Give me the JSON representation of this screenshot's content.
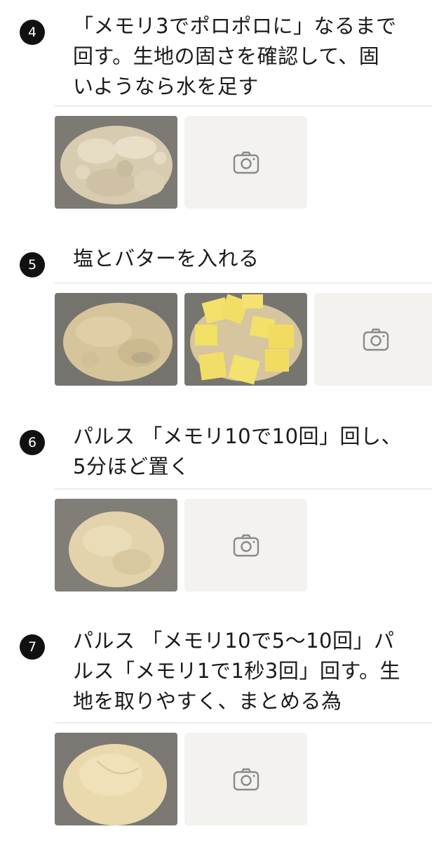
{
  "steps": [
    {
      "number": "4",
      "text": "「メモリ3でポロポロに」なるまで\n回す。生地の固さを確認して、固\nいようなら水を足す",
      "photos": [
        "crumbly-dough-photo"
      ]
    },
    {
      "number": "5",
      "text": "塩とバターを入れる",
      "photos": [
        "salted-dough-photo",
        "butter-cubes-photo"
      ]
    },
    {
      "number": "6",
      "text": "パルス 「メモリ10で10回」回し、\n5分ほど置く",
      "photos": [
        "rested-dough-photo"
      ]
    },
    {
      "number": "7",
      "text": "パルス 「メモリ10で5〜10回」パ\nルス「メモリ1で1秒3回」回す。生\n地を取りやすく、まとめる為",
      "photos": [
        "dough-ball-photo"
      ]
    }
  ],
  "icons": {
    "add_photo": "camera-icon"
  },
  "colors": {
    "badge": "#111111",
    "placeholder_bg": "#f3f2ef",
    "icon": "#8a8a8a",
    "divider": "#ececec"
  }
}
